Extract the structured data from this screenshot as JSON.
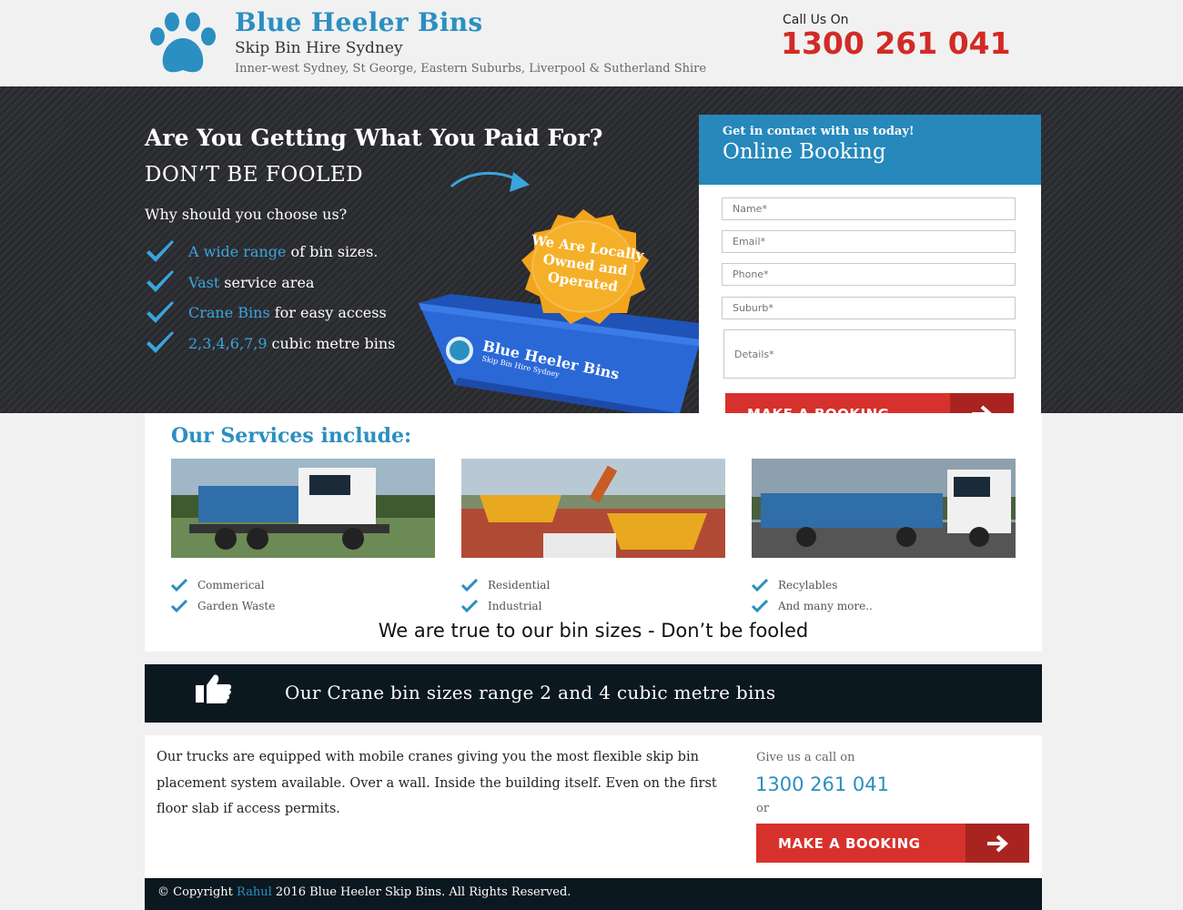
{
  "header": {
    "brand_name": "Blue Heeler Bins",
    "tagline": "Skip Bin Hire Sydney",
    "service_areas": "Inner-west Sydney, St George, Eastern Suburbs, Liverpool & Sutherland Shire",
    "call_label": "Call Us On",
    "phone": "1300 261 041",
    "logo_icon": "paw-icon"
  },
  "hero": {
    "title": "Are You Getting What You Paid For?",
    "subtitle": "DON’T BE FOOLED",
    "why_heading": "Why should you choose us?",
    "features": [
      {
        "highlight": "A wide range",
        "rest": "of bin sizes."
      },
      {
        "highlight": "Vast",
        "rest": "service area"
      },
      {
        "highlight": "Crane Bins",
        "rest": "for easy access"
      },
      {
        "highlight": "2,3,4,6,7,9",
        "rest": "cubic metre bins"
      }
    ],
    "seal_text": "We Are Locally Owned and Operated",
    "bin_brand": "Blue Heeler Bins",
    "bin_tagline": "Skip Bin Hire Sydney"
  },
  "booking": {
    "kicker": "Get in contact with us today!",
    "title": "Online Booking",
    "placeholders": {
      "name": "Name*",
      "email": "Email*",
      "phone": "Phone*",
      "suburb": "Suburb*",
      "details": "Details*"
    },
    "button_label": "MAKE A BOOKING",
    "button_icon": "arrow-right-icon"
  },
  "services": {
    "title": "Our Services include:",
    "columns": [
      {
        "items": [
          "Commerical",
          "Garden Waste"
        ]
      },
      {
        "items": [
          "Residential",
          "Industrial"
        ]
      },
      {
        "items": [
          "Recylables",
          "And many more.."
        ]
      }
    ],
    "tagline": "We are true to our bin sizes - Don’t be fooled"
  },
  "banner": {
    "icon": "thumbs-up-icon",
    "text": "Our Crane bin sizes range 2 and 4 cubic metre bins"
  },
  "info": {
    "text": "Our trucks are equipped with mobile cranes giving you the most flexible skip bin placement system available. Over a wall. Inside the building itself. Even on the first floor slab if access permits.",
    "give_call": "Give us a call on",
    "phone": "1300 261 041",
    "or": "or",
    "button_label": "MAKE A BOOKING"
  },
  "footer": {
    "prefix": "© Copyright",
    "author": "Rahul",
    "suffix": "2016 Blue Heeler Skip Bins. All Rights Reserved."
  },
  "colors": {
    "brand_blue": "#2b8fc1",
    "accent_red": "#d22b26",
    "dark_navy": "#0c1820",
    "hero_bg": "#2a2b30"
  }
}
